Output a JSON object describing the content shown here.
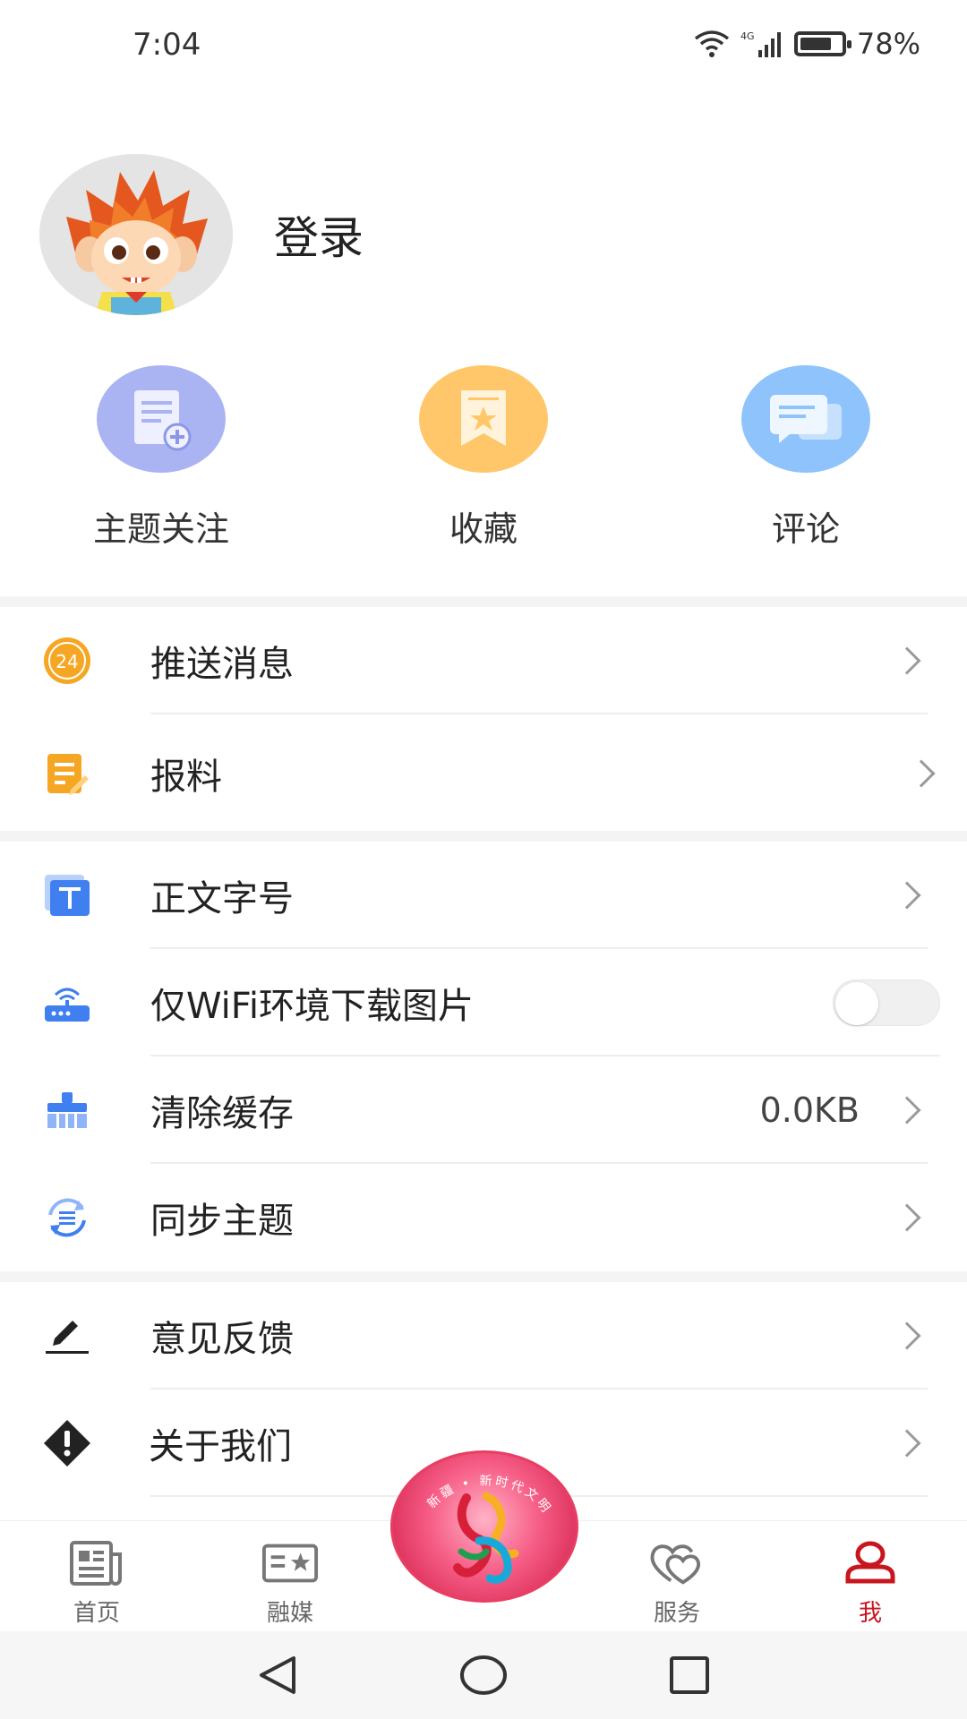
{
  "status_bar": {
    "time": "7:04",
    "network": "4G",
    "battery_level": 0.78,
    "battery": "78%"
  },
  "profile": {
    "login_label": "登录"
  },
  "quick_actions": [
    {
      "label": "主题关注",
      "icon": "document-add-icon",
      "color": "#aab4f3"
    },
    {
      "label": "收藏",
      "icon": "bookmark-star-icon",
      "color": "#ffc76a"
    },
    {
      "label": "评论",
      "icon": "chat-bubbles-icon",
      "color": "#8ec3fb"
    }
  ],
  "menu": {
    "push_messages": "推送消息",
    "report": "报料",
    "font_size": "正文字号",
    "wifi_images": "仅WiFi环境下载图片",
    "wifi_images_enabled": false,
    "clear_cache": "清除缓存",
    "cache_size": "0.0KB",
    "sync_topics": "同步主题",
    "feedback": "意见反馈",
    "about_us": "关于我们"
  },
  "badge_text": "新疆 • 新时代文明实践",
  "bottom_nav": [
    {
      "label": "首页",
      "icon": "newspaper-icon",
      "active": false
    },
    {
      "label": "融媒",
      "icon": "media-card-icon",
      "active": false
    },
    {
      "label": "服务",
      "icon": "heart-service-icon",
      "active": false
    },
    {
      "label": "我",
      "icon": "user-icon",
      "active": true
    }
  ],
  "colors": {
    "accent": "#c8161e",
    "orange": "#f5a623",
    "blue": "#3f7ff0"
  }
}
